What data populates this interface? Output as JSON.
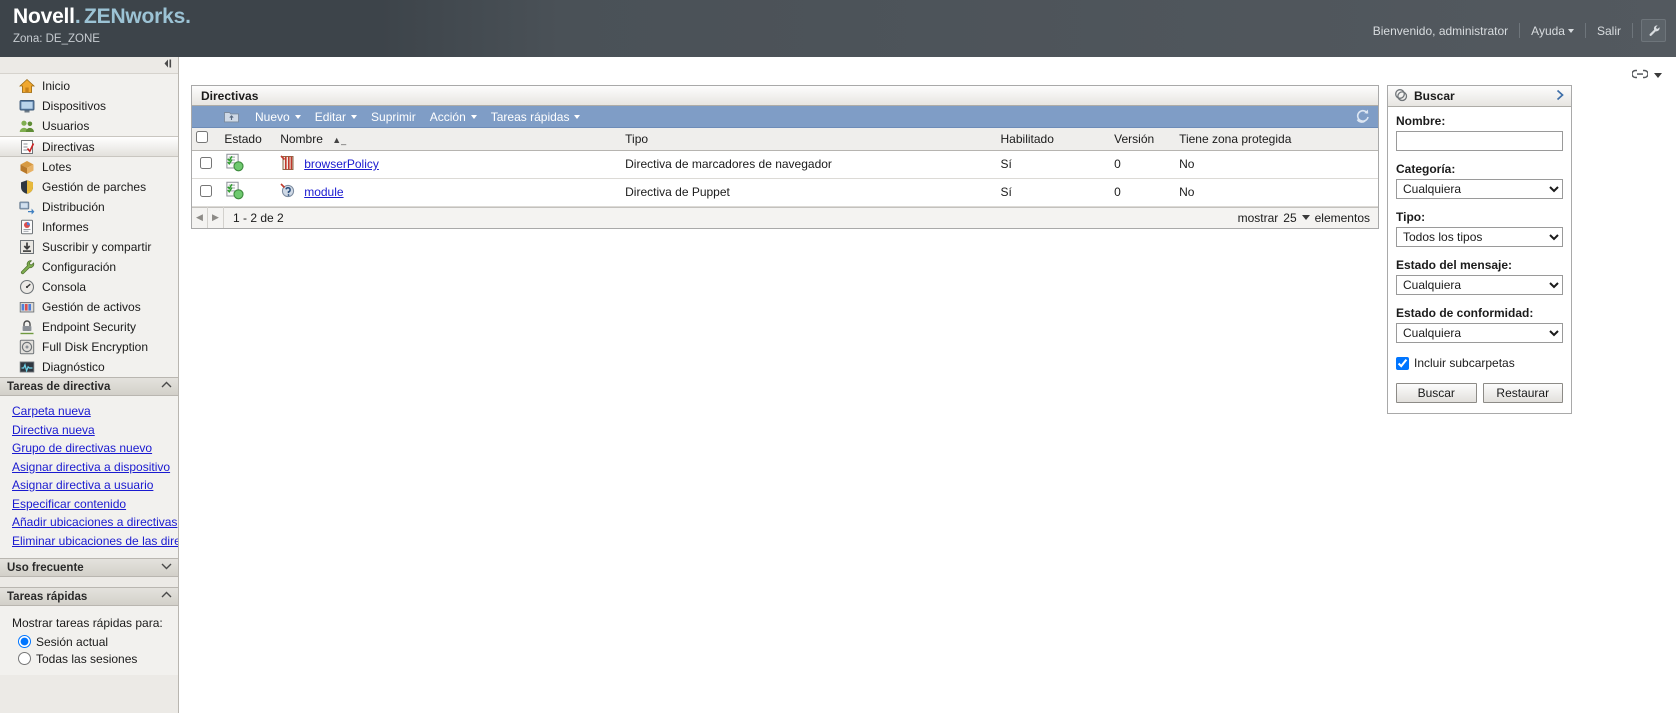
{
  "header": {
    "brand_novell": "Novell",
    "brand_zenworks": "ZENworks",
    "zone_label": "Zona: DE_ZONE",
    "welcome": "Bienvenido, administrator",
    "help_label": "Ayuda",
    "logout_label": "Salir",
    "wrench_icon": "wrench-icon",
    "brand_accent_color": "#9cc3d5",
    "bg_color": "#3d444a"
  },
  "sidebar": {
    "collapse_icon": "collapse-panel-icon",
    "nav_items": [
      {
        "label": "Inicio",
        "icon": "home-icon",
        "selected": false
      },
      {
        "label": "Dispositivos",
        "icon": "monitor-icon",
        "selected": false
      },
      {
        "label": "Usuarios",
        "icon": "users-icon",
        "selected": false
      },
      {
        "label": "Directivas",
        "icon": "policy-checklist-icon",
        "selected": true
      },
      {
        "label": "Lotes",
        "icon": "bundle-box-icon",
        "selected": false
      },
      {
        "label": "Gestión de parches",
        "icon": "patch-shield-icon",
        "selected": false
      },
      {
        "label": "Distribución",
        "icon": "deployment-icon",
        "selected": false
      },
      {
        "label": "Informes",
        "icon": "report-chart-icon",
        "selected": false
      },
      {
        "label": "Suscribir y compartir",
        "icon": "subscribe-download-icon",
        "selected": false
      },
      {
        "label": "Configuración",
        "icon": "wrench-icon",
        "selected": false
      },
      {
        "label": "Consola",
        "icon": "console-gauge-icon",
        "selected": false
      },
      {
        "label": "Gestión de activos",
        "icon": "asset-management-icon",
        "selected": false
      },
      {
        "label": "Endpoint Security",
        "icon": "endpoint-security-lock-icon",
        "selected": false
      },
      {
        "label": "Full Disk Encryption",
        "icon": "disk-encryption-icon",
        "selected": false
      },
      {
        "label": "Diagnóstico",
        "icon": "diagnostics-waveform-icon",
        "selected": false
      }
    ],
    "policy_tasks": {
      "title": "Tareas de directiva",
      "chevron": "chevron-up-icon",
      "links": [
        "Carpeta nueva",
        "Directiva nueva",
        "Grupo de directivas nuevo",
        "Asignar directiva a dispositivo",
        "Asignar directiva a usuario",
        "Especificar contenido",
        "Añadir ubicaciones a directivas",
        "Eliminar ubicaciones de las directivas"
      ]
    },
    "frequent_use": {
      "title": "Uso frecuente",
      "chevron": "chevron-down-icon"
    },
    "quick_tasks": {
      "title": "Tareas rápidas",
      "chevron": "chevron-up-icon",
      "prompt": "Mostrar tareas rápidas para:",
      "options": [
        {
          "label": "Sesión actual",
          "selected": true
        },
        {
          "label": "Todas las sesiones",
          "selected": false
        }
      ]
    }
  },
  "main": {
    "top_icons": {
      "link_icon": "chain-link-icon",
      "caret_icon": "caret-down-icon"
    },
    "panel_title": "Directivas",
    "toolbar": {
      "folder_up_icon": "folder-up-icon",
      "items": [
        {
          "label": "Nuevo",
          "has_caret": true
        },
        {
          "label": "Editar",
          "has_caret": true
        },
        {
          "label": "Suprimir",
          "has_caret": false
        },
        {
          "label": "Acción",
          "has_caret": true
        },
        {
          "label": "Tareas rápidas",
          "has_caret": true
        }
      ],
      "refresh_icon": "refresh-icon",
      "bg_color": "#7f9dc6"
    },
    "table": {
      "columns": [
        "Estado",
        "Nombre",
        "Tipo",
        "Habilitado",
        "Versión",
        "Tiene zona protegida"
      ],
      "sort_column": "Nombre",
      "sort_direction": "asc",
      "rows": [
        {
          "status_icon": "policy-status-ok-icon",
          "type_icon": "browser-bookmark-policy-icon",
          "name": "browserPolicy",
          "tipo": "Directiva de marcadores de navegador",
          "habilitado": "Sí",
          "version": "0",
          "zona_protegida": "No"
        },
        {
          "status_icon": "policy-status-ok-icon",
          "type_icon": "puppet-policy-icon",
          "name": "module",
          "tipo": "Directiva de Puppet",
          "habilitado": "Sí",
          "version": "0",
          "zona_protegida": "No"
        }
      ]
    },
    "pager": {
      "prev_icon": "prev-page-icon",
      "next_icon": "next-page-icon",
      "range": "1 - 2 de 2",
      "show_label": "mostrar",
      "page_size": "25",
      "items_label": "elementos"
    }
  },
  "search": {
    "icon": "search-badge-icon",
    "title": "Buscar",
    "expand_icon": "chevron-right-icon",
    "fields": [
      {
        "label": "Nombre:",
        "type": "text",
        "value": "",
        "placeholder": ""
      },
      {
        "label": "Categoría:",
        "type": "select",
        "value": "Cualquiera"
      },
      {
        "label": "Tipo:",
        "type": "select",
        "value": "Todos los tipos"
      },
      {
        "label": "Estado del mensaje:",
        "type": "select",
        "value": "Cualquiera"
      },
      {
        "label": "Estado de conformidad:",
        "type": "select",
        "value": "Cualquiera"
      }
    ],
    "include_subfolders": {
      "label": "Incluir subcarpetas",
      "checked": true
    },
    "buttons": [
      {
        "label": "Buscar"
      },
      {
        "label": "Restaurar"
      }
    ]
  }
}
